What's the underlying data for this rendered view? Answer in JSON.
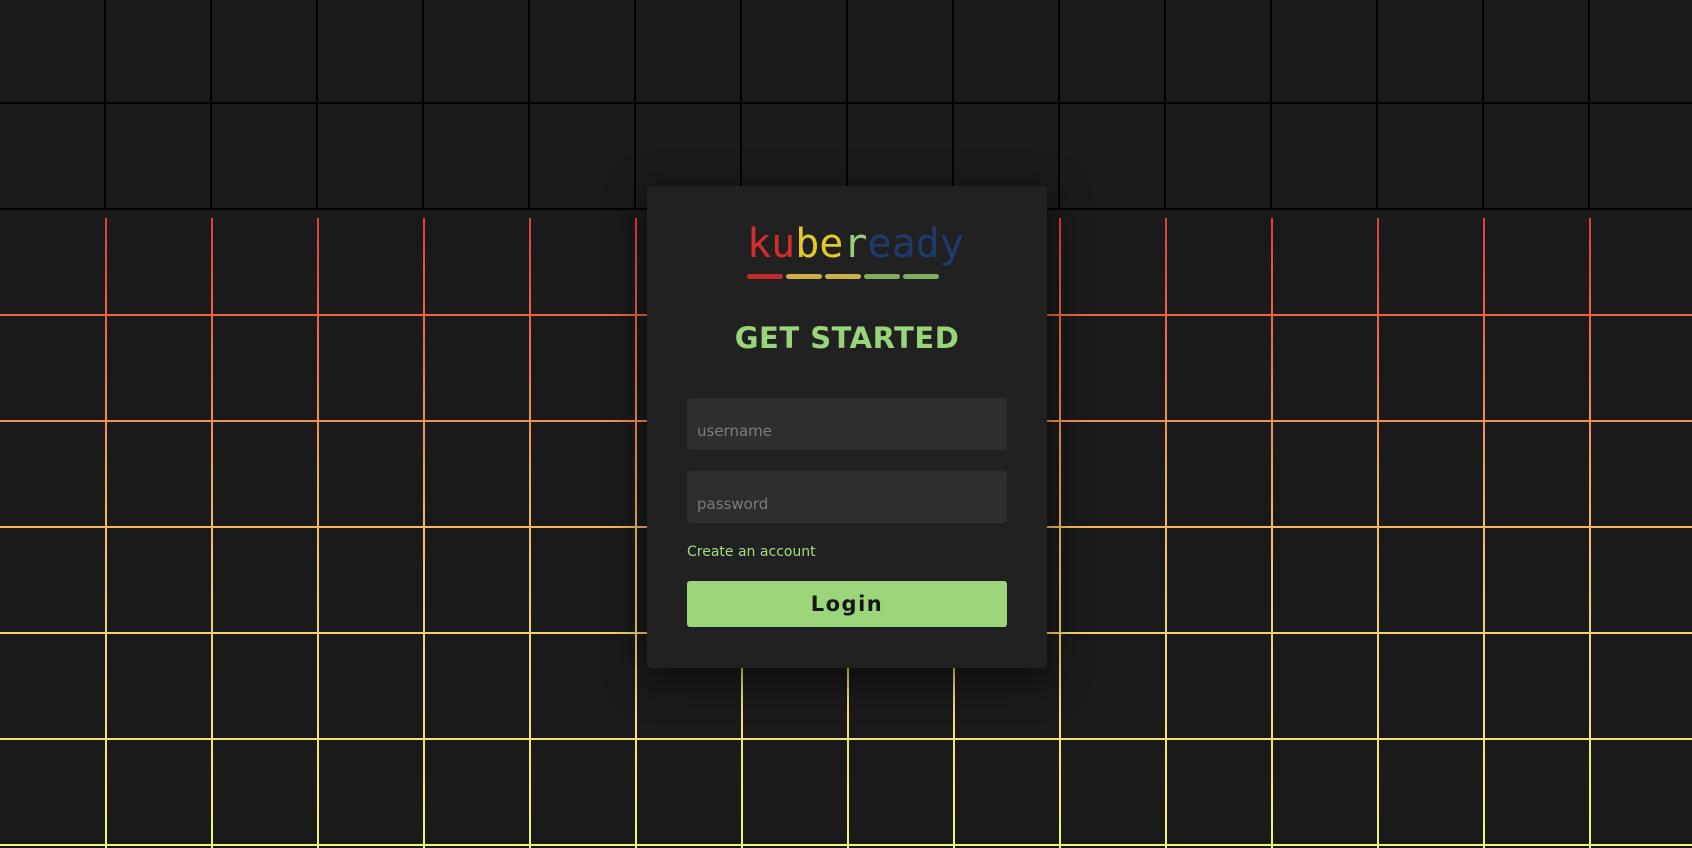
{
  "logo": {
    "letters": [
      {
        "char": "k",
        "color": "#d42d2d"
      },
      {
        "char": "u",
        "color": "#d42d2d"
      },
      {
        "char": "b",
        "color": "#e4c92a"
      },
      {
        "char": "e",
        "color": "#e4c92a"
      },
      {
        "char": "r",
        "color": "#97d27a"
      },
      {
        "char": "e",
        "color": "#1f3a6e"
      },
      {
        "char": "a",
        "color": "#1f3a6e"
      },
      {
        "char": "d",
        "color": "#1f3a6e"
      },
      {
        "char": "y",
        "color": "#1f3a6e"
      }
    ],
    "bar_colors": [
      "#c22b2b",
      "#c9b04a",
      "#c9b04a",
      "#7fae63",
      "#7fae63"
    ]
  },
  "form": {
    "title": "GET STARTED",
    "username_placeholder": "username",
    "password_placeholder": "password",
    "create_account_label": "Create an account",
    "login_label": "Login"
  },
  "colors": {
    "background": "#1a1a1a",
    "card": "#212121",
    "accent": "#9bd67a"
  }
}
